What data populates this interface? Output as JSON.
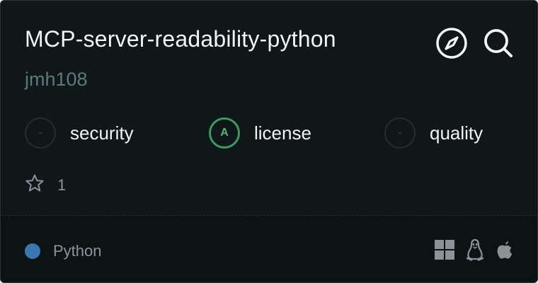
{
  "card": {
    "title": "MCP-server-readability-python",
    "owner": "jmh108",
    "icons": {
      "explore": "compass-icon",
      "inspect": "search-icon"
    },
    "scores": [
      {
        "name": "security",
        "grade": "-",
        "status": "none"
      },
      {
        "name": "license",
        "grade": "A",
        "status": "grade-a"
      },
      {
        "name": "quality",
        "grade": "-",
        "status": "none"
      }
    ],
    "stars": {
      "icon": "star-icon",
      "count": "1"
    },
    "language": {
      "name": "Python",
      "color": "#3b76b3"
    },
    "platforms": [
      "windows-icon",
      "linux-icon",
      "apple-icon"
    ]
  },
  "colors": {
    "background": "#0f1719",
    "footer": "#0c1315",
    "accent_grade_a": "#3e9a63",
    "title": "#f2f4f5",
    "owner": "#5b7a78"
  }
}
